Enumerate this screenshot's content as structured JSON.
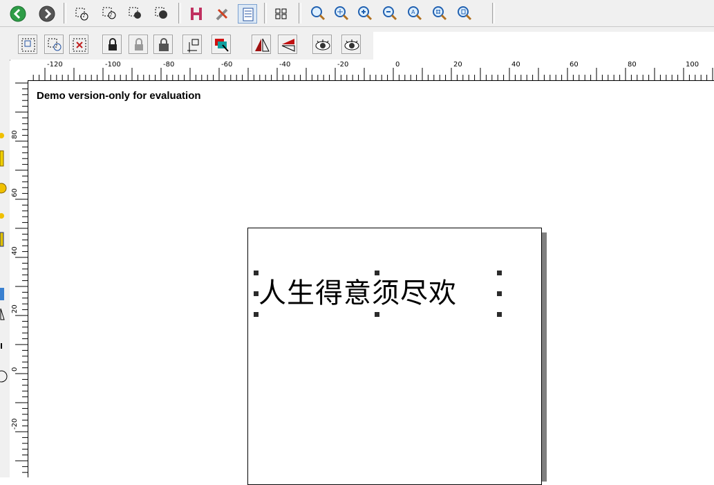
{
  "toolbar_main": {
    "buttons": [
      {
        "name": "back-button",
        "icon": "arrow-left-circle-icon"
      },
      {
        "name": "forward-button",
        "icon": "arrow-right-circle-icon"
      },
      {
        "name": "select-objects-button",
        "icon": "select-icon"
      },
      {
        "name": "select-group-button",
        "icon": "select-group-icon"
      },
      {
        "name": "select-object-a-button",
        "icon": "select-filled-icon"
      },
      {
        "name": "select-object-b-button",
        "icon": "select-filled-icon"
      },
      {
        "name": "text-spacing-button",
        "icon": "h-spacing-icon"
      },
      {
        "name": "tools-button",
        "icon": "tools-icon"
      },
      {
        "name": "properties-button",
        "icon": "list-panel-icon"
      },
      {
        "name": "tab-order-button",
        "icon": "number-order-icon"
      },
      {
        "name": "zoom-button",
        "icon": "magnifier-icon"
      },
      {
        "name": "zoom-pan-button",
        "icon": "zoom-pan-icon"
      },
      {
        "name": "zoom-in-button",
        "icon": "zoom-in-icon"
      },
      {
        "name": "zoom-out-button",
        "icon": "zoom-out-icon"
      },
      {
        "name": "zoom-all-button",
        "icon": "zoom-all-icon"
      },
      {
        "name": "zoom-grid-button",
        "icon": "zoom-grid-icon"
      },
      {
        "name": "zoom-page-button",
        "icon": "zoom-page-icon"
      }
    ]
  },
  "toolbar_objects": {
    "buttons": [
      {
        "name": "group-button",
        "icon": "group-icon"
      },
      {
        "name": "ungroup-button",
        "icon": "ungroup-icon"
      },
      {
        "name": "remove-selection-button",
        "icon": "select-remove-icon"
      },
      {
        "name": "lock-button",
        "icon": "lock-icon"
      },
      {
        "name": "unlock-button",
        "icon": "unlock-icon"
      },
      {
        "name": "lock-all-button",
        "icon": "lock-all-icon"
      },
      {
        "name": "origin-button",
        "icon": "origin-icon"
      },
      {
        "name": "layer-order-button",
        "icon": "layers-icon"
      },
      {
        "name": "mirror-horizontal-button",
        "icon": "mirror-horizontal-icon"
      },
      {
        "name": "mirror-vertical-button",
        "icon": "mirror-vertical-icon"
      },
      {
        "name": "preview-button",
        "icon": "eye-icon"
      },
      {
        "name": "preview-all-button",
        "icon": "eye-icon"
      }
    ]
  },
  "rulers": {
    "horizontal_labels": [
      "-120",
      "-100",
      "-80",
      "-60",
      "-40",
      "-20",
      "0",
      "20",
      "40",
      "60",
      "80",
      "100"
    ],
    "vertical_labels": [
      "80",
      "60",
      "40",
      "20",
      "0",
      "-20"
    ]
  },
  "canvas": {
    "demo_notice": "Demo version-only for evaluation",
    "text_object": "人生得意须尽欢"
  }
}
